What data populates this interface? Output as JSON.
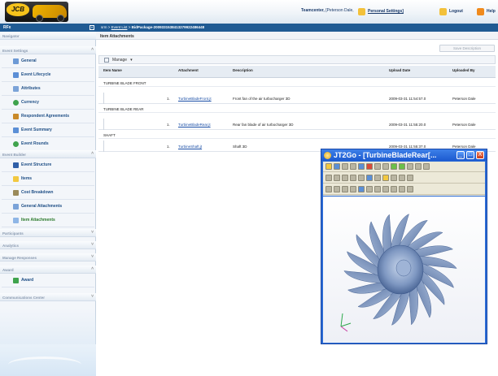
{
  "header": {
    "logo_text": "JCB",
    "user_name": "Teamcenter,",
    "user_detail": "[Peterson Dale,",
    "personal_settings": "Personal Settings]",
    "logout": "Logout",
    "help": "Help"
  },
  "leftbar_title": "RFx",
  "collapse_glyph": "«",
  "breadcrumb": {
    "root": "srm",
    "sep1": ">",
    "event_list": "Event List",
    "sep2": ">",
    "current": "BidPackage-2009331538413279922486448"
  },
  "sidebar": {
    "navigator": "Navigator",
    "event_settings": "Event Settings",
    "settings_items": [
      "General",
      "Event Lifecycle",
      "Attributes",
      "Currency",
      "Respondent Agreements",
      "Event Summary",
      "Event Rounds"
    ],
    "event_builder": "Event Builder",
    "builder_items": [
      "Event Structure",
      "Items",
      "Cost Breakdown",
      "General Attachments",
      "Item Attachments"
    ],
    "participants": "Participants",
    "analytics": "Analytics",
    "manage_responses": "Manage Responses",
    "award": "Award",
    "award_items": [
      "Award"
    ],
    "communications": "Communications Center"
  },
  "content": {
    "title": "Item Attachments",
    "save_description": "Save Description",
    "manage": "Manage",
    "columns": {
      "item_name": "Item Name",
      "attachment": "Attachment",
      "description": "Description",
      "upload_date": "Upload Date",
      "uploaded_by": "Uploaded By"
    },
    "groups": [
      {
        "name": "TURBINE BLADE FRONT",
        "num": "1.",
        "attachment": "TurbineBladeFront.jt",
        "description": "Front fan of the air turbocharger 3D",
        "date": "2009-03-31 11:54:57.0",
        "by": "Peterson Dale"
      },
      {
        "name": "TURBINE BLADE REAR",
        "num": "1.",
        "attachment": "TurbineBladeRear.jt",
        "description": "Rear fan blade of air turbocharger 3D",
        "date": "2009-03-31 11:55:20.0",
        "by": "Peterson Dale"
      },
      {
        "name": "SHAFT",
        "num": "1.",
        "attachment": "TurbineShaft.jt",
        "description": "Shaft 3D",
        "date": "2009-03-31 11:55:37.0",
        "by": "Peterson Dale"
      }
    ]
  },
  "viewer": {
    "title": "JT2Go - [TurbineBladeRear[...",
    "min": "_",
    "max": "□",
    "close": "X"
  },
  "colors": {
    "header_blue": "#1f5a93",
    "link_blue": "#1a4ea6",
    "active_green": "#2b7a2b",
    "window_blue": "#2a6ad4"
  }
}
